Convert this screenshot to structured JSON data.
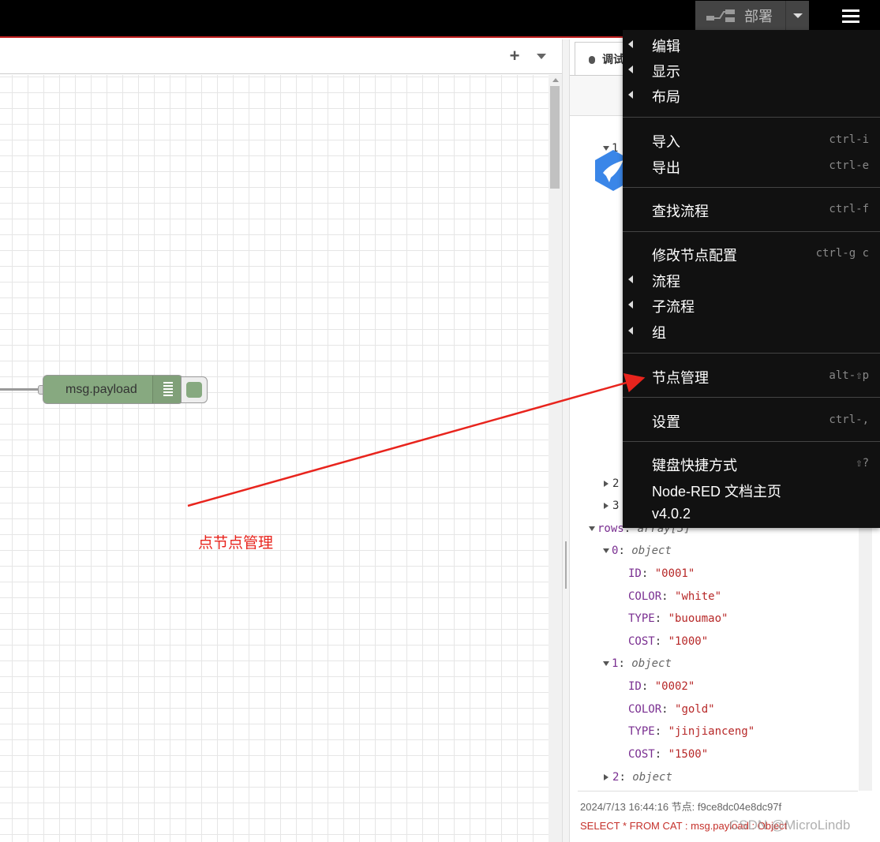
{
  "header": {
    "deploy_label": "部署"
  },
  "workspace": {
    "node_label": "msg.payload",
    "annotation": "点节点管理"
  },
  "sidebar": {
    "tab_label": "调试",
    "debug_lines": {
      "item1": "1",
      "item2": "2",
      "item3": "3",
      "rows_key": "rows",
      "rows_type": "array[3]",
      "r0_key": "0",
      "r0_type": "object",
      "r0_id_key": "ID",
      "r0_id": "\"0001\"",
      "r0_color_key": "COLOR",
      "r0_color": "\"white\"",
      "r0_type_key": "TYPE",
      "r0_type_val": "\"buoumao\"",
      "r0_cost_key": "COST",
      "r0_cost": "\"1000\"",
      "r1_key": "1",
      "r1_type": "object",
      "r1_id_key": "ID",
      "r1_id": "\"0002\"",
      "r1_color_key": "COLOR",
      "r1_color": "\"gold\"",
      "r1_type_key": "TYPE",
      "r1_type_val": "\"jinjianceng\"",
      "r1_cost_key": "COST",
      "r1_cost": "\"1500\"",
      "r2_key": "2",
      "r2_type": "object"
    },
    "footer_meta": "2024/7/13 16:44:16   节点: f9ce8dc04e8dc97f",
    "footer_topic": "SELECT * FROM CAT : msg.payload : Object"
  },
  "watermark": "CSDN @MicroLindb",
  "menu": {
    "items": [
      {
        "label": "编辑",
        "shortcut": ""
      },
      {
        "label": "显示",
        "shortcut": ""
      },
      {
        "label": "布局",
        "shortcut": ""
      },
      {
        "label": "导入",
        "shortcut": "ctrl-i"
      },
      {
        "label": "导出",
        "shortcut": "ctrl-e"
      },
      {
        "label": "查找流程",
        "shortcut": "ctrl-f"
      },
      {
        "label": "修改节点配置",
        "shortcut": "ctrl-g c"
      },
      {
        "label": "流程",
        "shortcut": ""
      },
      {
        "label": "子流程",
        "shortcut": ""
      },
      {
        "label": "组",
        "shortcut": ""
      },
      {
        "label": "节点管理",
        "shortcut": "alt-⇧p"
      },
      {
        "label": "设置",
        "shortcut": "ctrl-,"
      },
      {
        "label": "键盘快捷方式",
        "shortcut": "⇧?"
      },
      {
        "label": "Node-RED 文档主页",
        "shortcut": ""
      },
      {
        "label": "v4.0.2",
        "shortcut": ""
      }
    ]
  },
  "colors": {
    "header_bg": "#000000",
    "header_border": "#c02020",
    "node_fill": "#87a980",
    "annotation": "#e8241d",
    "menu_bg": "#111111"
  },
  "icons": [
    "deploy-icon",
    "hamburger-menu-icon",
    "add-tab-icon",
    "tab-menu-caret-icon",
    "bug-icon",
    "list-icon",
    "bird-logo-icon",
    "submenu-caret-icon"
  ]
}
